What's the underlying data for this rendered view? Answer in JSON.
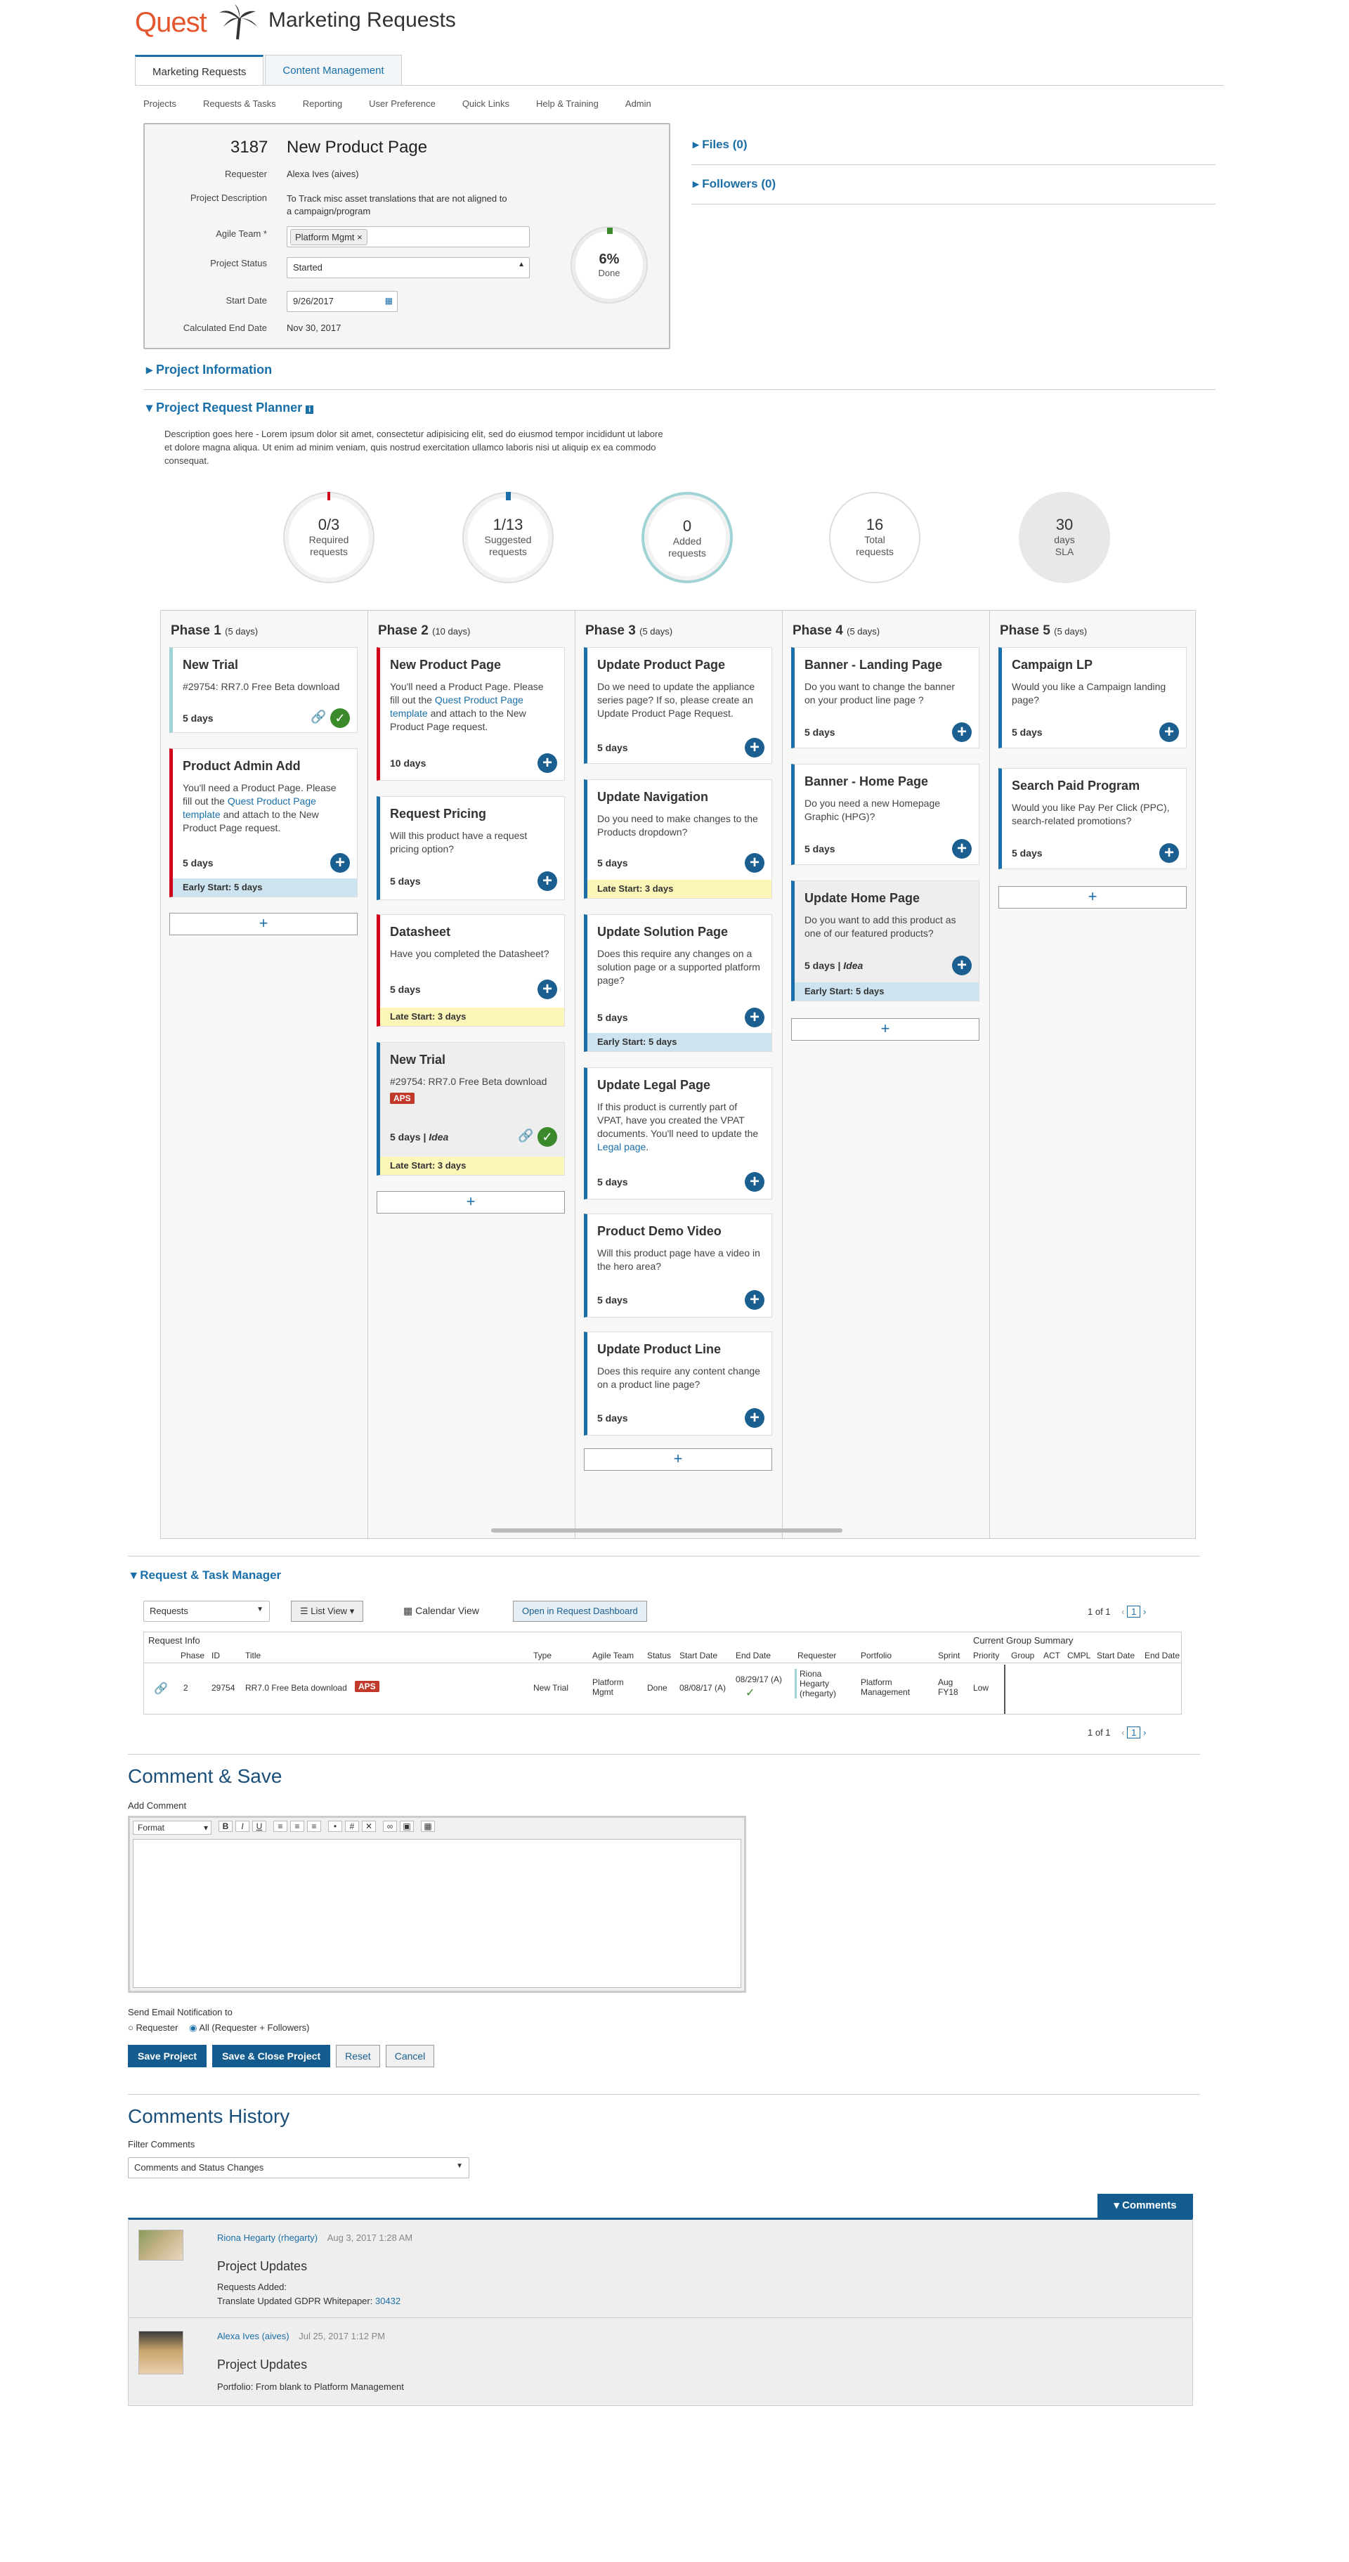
{
  "header": {
    "logo": "Quest",
    "title": "Marketing Requests"
  },
  "tabs": [
    "Marketing Requests",
    "Content Management"
  ],
  "subnav": [
    "Projects",
    "Requests & Tasks",
    "Reporting",
    "User Preference",
    "Quick Links",
    "Help & Training",
    "Admin"
  ],
  "project": {
    "id": "3187",
    "name": "New Product Page",
    "labels": {
      "requester": "Requester",
      "description": "Project Description",
      "team": "Agile Team *",
      "status": "Project Status",
      "start": "Start Date",
      "end": "Calculated End Date"
    },
    "requester": "Alexa Ives (aives)",
    "description": "To Track misc asset translations that are not aligned to a campaign/program",
    "team": "Platform Mgmt",
    "status": "Started",
    "start_date": "9/26/2017",
    "end_date": "Nov 30, 2017",
    "progress_percent": 6,
    "progress_label": "6%",
    "progress_sub": "Done"
  },
  "side": {
    "files": "Files (0)",
    "followers": "Followers (0)"
  },
  "sections": {
    "info": "Project Information",
    "planner": "Project Request Planner",
    "planner_desc": "Description goes here - Lorem ipsum dolor sit amet, consectetur adipisicing elit, sed do eiusmod tempor incididunt ut labore et dolore magna aliqua. Ut enim ad minim veniam, quis nostrud exercitation ullamco laboris nisi ut aliquip ex ea commodo consequat."
  },
  "stats": [
    {
      "n": "0/3",
      "t1": "Required",
      "t2": "requests"
    },
    {
      "n": "1/13",
      "t1": "Suggested",
      "t2": "requests"
    },
    {
      "n": "0",
      "t1": "Added",
      "t2": "requests"
    },
    {
      "n": "16",
      "t1": "Total",
      "t2": "requests"
    },
    {
      "n": "30",
      "t1": "days",
      "t2": "SLA"
    }
  ],
  "phases": [
    {
      "name": "Phase 1",
      "days": "(5 days)"
    },
    {
      "name": "Phase 2",
      "days": "(10 days)"
    },
    {
      "name": "Phase 3",
      "days": "(5 days)"
    },
    {
      "name": "Phase 4",
      "days": "(5 days)"
    },
    {
      "name": "Phase 5",
      "days": "(5 days)"
    }
  ],
  "cards": {
    "p1c1": {
      "title": "New Trial",
      "link": "#29754: RR7.0 Free Beta download",
      "days": "5 days"
    },
    "p1c2": {
      "title": "Product Admin Add",
      "d1": "You'll need a Product Page. Please fill out the ",
      "link": "Quest Product Page template",
      "d2": " and attach to the New Product Page request.",
      "days": "5 days",
      "strip": "Early Start: 5 days"
    },
    "p2c1": {
      "title": "New Product Page",
      "d1": "You'll need a Product Page. Please fill out the ",
      "link": "Quest Product Page template",
      "d2": " and attach to the New Product Page request.",
      "days": "10 days"
    },
    "p2c2": {
      "title": "Request Pricing",
      "desc": "Will this product have a request pricing option?",
      "days": "5 days"
    },
    "p2c3": {
      "title": "Datasheet",
      "desc": "Have you completed the Datasheet?",
      "days": "5 days",
      "strip": "Late Start: 3 days"
    },
    "p2c4": {
      "title": "New Trial",
      "link": "#29754: RR7.0 Free Beta download",
      "badge": "APS",
      "days": "5 days",
      "idea": "Idea",
      "strip": "Late Start: 3 days"
    },
    "p3c1": {
      "title": "Update Product Page",
      "desc": "Do we need to update the appliance series page? If so, please create an Update Product Page Request.",
      "days": "5 days"
    },
    "p3c2": {
      "title": "Update Navigation",
      "desc": "Do you need to make changes to the Products dropdown?",
      "days": "5 days",
      "strip": "Late Start: 3 days"
    },
    "p3c3": {
      "title": "Update Solution Page",
      "desc": "Does this require any changes on a solution page or a supported platform page?",
      "days": "5 days",
      "strip": "Early Start: 5 days"
    },
    "p3c4": {
      "title": "Update Legal Page",
      "d1": "If this product is currently part of VPAT, have you created the VPAT documents. You'll need to update the ",
      "link": "Legal page",
      "d2": ".",
      "days": "5 days"
    },
    "p3c5": {
      "title": "Product Demo Video",
      "desc": "Will this product page have a video in the hero area?",
      "days": "5 days"
    },
    "p3c6": {
      "title": "Update Product Line",
      "desc": "Does this require any content change on a product line page?",
      "days": "5 days"
    },
    "p4c1": {
      "title": "Banner - Landing Page",
      "desc": "Do you want to change the banner on your product line page ?",
      "days": "5 days"
    },
    "p4c2": {
      "title": "Banner - Home Page",
      "desc": "Do you need a new Homepage Graphic (HPG)?",
      "days": "5 days"
    },
    "p4c3": {
      "title": "Update Home Page",
      "desc": "Do you want to add this product as one of our featured products?",
      "days": "5 days",
      "idea": "Idea",
      "strip": "Early Start: 5 days"
    },
    "p5c1": {
      "title": "Campaign LP",
      "desc": "Would you like a Campaign landing page?",
      "days": "5 days"
    },
    "p5c2": {
      "title": "Search Paid Program",
      "desc": "Would you like Pay Per Click (PPC), search-related promotions?",
      "days": "5 days"
    }
  },
  "plus": "+",
  "rtm": {
    "title": "Request & Task Manager",
    "select": "Requests",
    "listview": "List View",
    "calendar": "Calendar View",
    "dashboard": "Open in Request Dashboard",
    "pager": "1 of 1",
    "page": "1",
    "reqinfo": "Request Info",
    "group": "Current Group Summary",
    "cols": [
      "Phase",
      "ID",
      "Title",
      "Type",
      "Agile Team",
      "Status",
      "Start Date",
      "End Date",
      "Requester",
      "Portfolio",
      "Sprint",
      "Priority",
      "Group",
      "ACT",
      "CMPL",
      "Start Date",
      "End Date"
    ],
    "row": {
      "phase": "2",
      "id": "29754",
      "title": "RR7.0 Free Beta download",
      "badge": "APS",
      "type": "New Trial",
      "team": "Platform Mgmt",
      "status": "Done",
      "start": "08/08/17 (A)",
      "end": "08/29/17 (A)",
      "requester": "Riona Hegarty (rhegarty)",
      "portfolio": "Platform Management",
      "sprint": "Aug FY18",
      "priority": "Low"
    }
  },
  "comment": {
    "title": "Comment & Save",
    "add": "Add Comment",
    "format": "Format",
    "notify": "Send Email Notification to",
    "opt1": "Requester",
    "opt2": "All (Requester + Followers)",
    "save": "Save Project",
    "saveclose": "Save & Close Project",
    "reset": "Reset",
    "cancel": "Cancel"
  },
  "history": {
    "title": "Comments History",
    "filter": "Filter Comments",
    "filter_value": "Comments and Status Changes",
    "tab": "Comments",
    "items": [
      {
        "user": "Riona Hegarty (rhegarty)",
        "date": "Aug 3, 2017 1:28 AM",
        "heading": "Project Updates",
        "l1": "Requests Added:",
        "l2": "Translate Updated GDPR Whitepaper: ",
        "l2link": "30432"
      },
      {
        "user": "Alexa Ives (aives)",
        "date": "Jul 25, 2017 1:12 PM",
        "heading": "Project Updates",
        "l1": "Portfolio: From blank to Platform Management"
      }
    ]
  },
  "colors": {
    "accent": "#1a6fa8",
    "brand": "#e4572e",
    "danger": "#d0021b",
    "success": "#3a8a2c"
  }
}
